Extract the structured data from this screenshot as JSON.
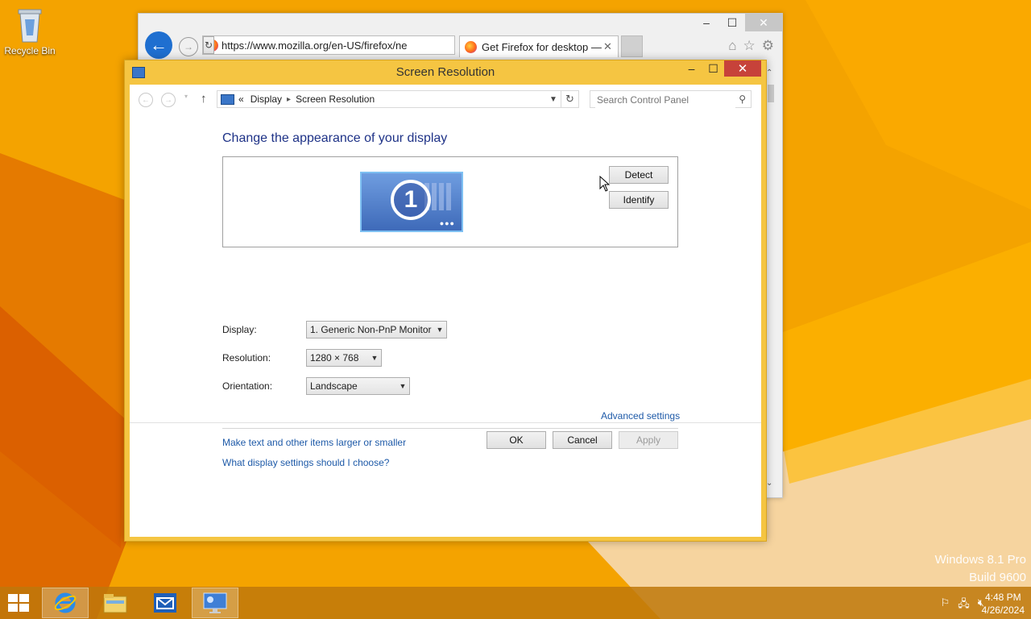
{
  "desktop": {
    "recycle_bin_label": "Recycle Bin",
    "watermark_line1": "Windows 8.1 Pro",
    "watermark_line2": "Build 9600"
  },
  "browser": {
    "address": "https://www.mozilla.org/en-US/firefox/ne",
    "tab_title": "Get Firefox for desktop — ...",
    "caption": {
      "minimize": "–",
      "maximize": "☐",
      "close": "✕"
    }
  },
  "dialog": {
    "title": "Screen Resolution",
    "breadcrumb": {
      "chevrons": "«",
      "items": [
        "Display",
        "Screen Resolution"
      ]
    },
    "search_placeholder": "Search Control Panel",
    "heading": "Change the appearance of your display",
    "monitor_number": "1",
    "detect_label": "Detect",
    "identify_label": "Identify",
    "display_label": "Display:",
    "display_value": "1. Generic Non-PnP Monitor",
    "resolution_label": "Resolution:",
    "resolution_value": "1280 × 768",
    "orientation_label": "Orientation:",
    "orientation_value": "Landscape",
    "advanced_link": "Advanced settings",
    "link_text_size": "Make text and other items larger or smaller",
    "link_display_settings": "What display settings should I choose?",
    "ok_label": "OK",
    "cancel_label": "Cancel",
    "apply_label": "Apply"
  },
  "taskbar": {
    "items": [
      "internet-explorer-icon",
      "file-explorer-icon",
      "mail-icon",
      "control-panel-icon"
    ],
    "time": "4:48 PM",
    "date": "4/26/2024"
  },
  "colors": {
    "accent": "#f5c542",
    "link": "#1e5aa8",
    "heading": "#1e3287"
  }
}
